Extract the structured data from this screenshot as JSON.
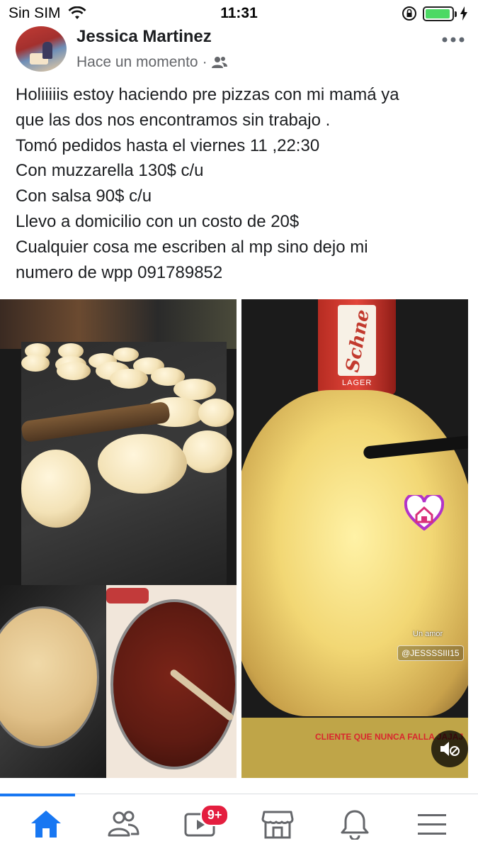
{
  "status_bar": {
    "carrier": "Sin SIM",
    "time": "11:31",
    "battery_level": 0.95
  },
  "post": {
    "author": "Jessica Martinez",
    "timestamp": "Hace un momento",
    "separator": "·",
    "audience_icon": "friends-icon",
    "lines": [
      "Holiiiiis estoy haciendo pre pizzas con mi mamá ya",
      "que las dos nos encontramos sin trabajo .",
      "Tomó pedidos hasta el viernes 11 ,22:30",
      "Con muzzarella 130$ c/u",
      "Con salsa 90$ c/u",
      "Llevo a domicilio con un costo de 20$",
      "Cualquier cosa me escriben al mp sino dejo mi",
      "numero de wpp 091789852"
    ]
  },
  "photos": {
    "pizza": {
      "can_brand": "Schne",
      "can_type": "LAGER",
      "sticker_text": "Un amor",
      "username_tag": "@JESSSSIII15",
      "caption": "CLIENTE QUE NUNCA FALLA JAJAJ"
    }
  },
  "bottom_nav": {
    "video_badge": "9+",
    "items": [
      "home-icon",
      "friends-icon",
      "watch-icon",
      "marketplace-icon",
      "notifications-icon",
      "menu-icon"
    ]
  },
  "colors": {
    "accent": "#1877f2",
    "badge": "#e41e3f"
  }
}
